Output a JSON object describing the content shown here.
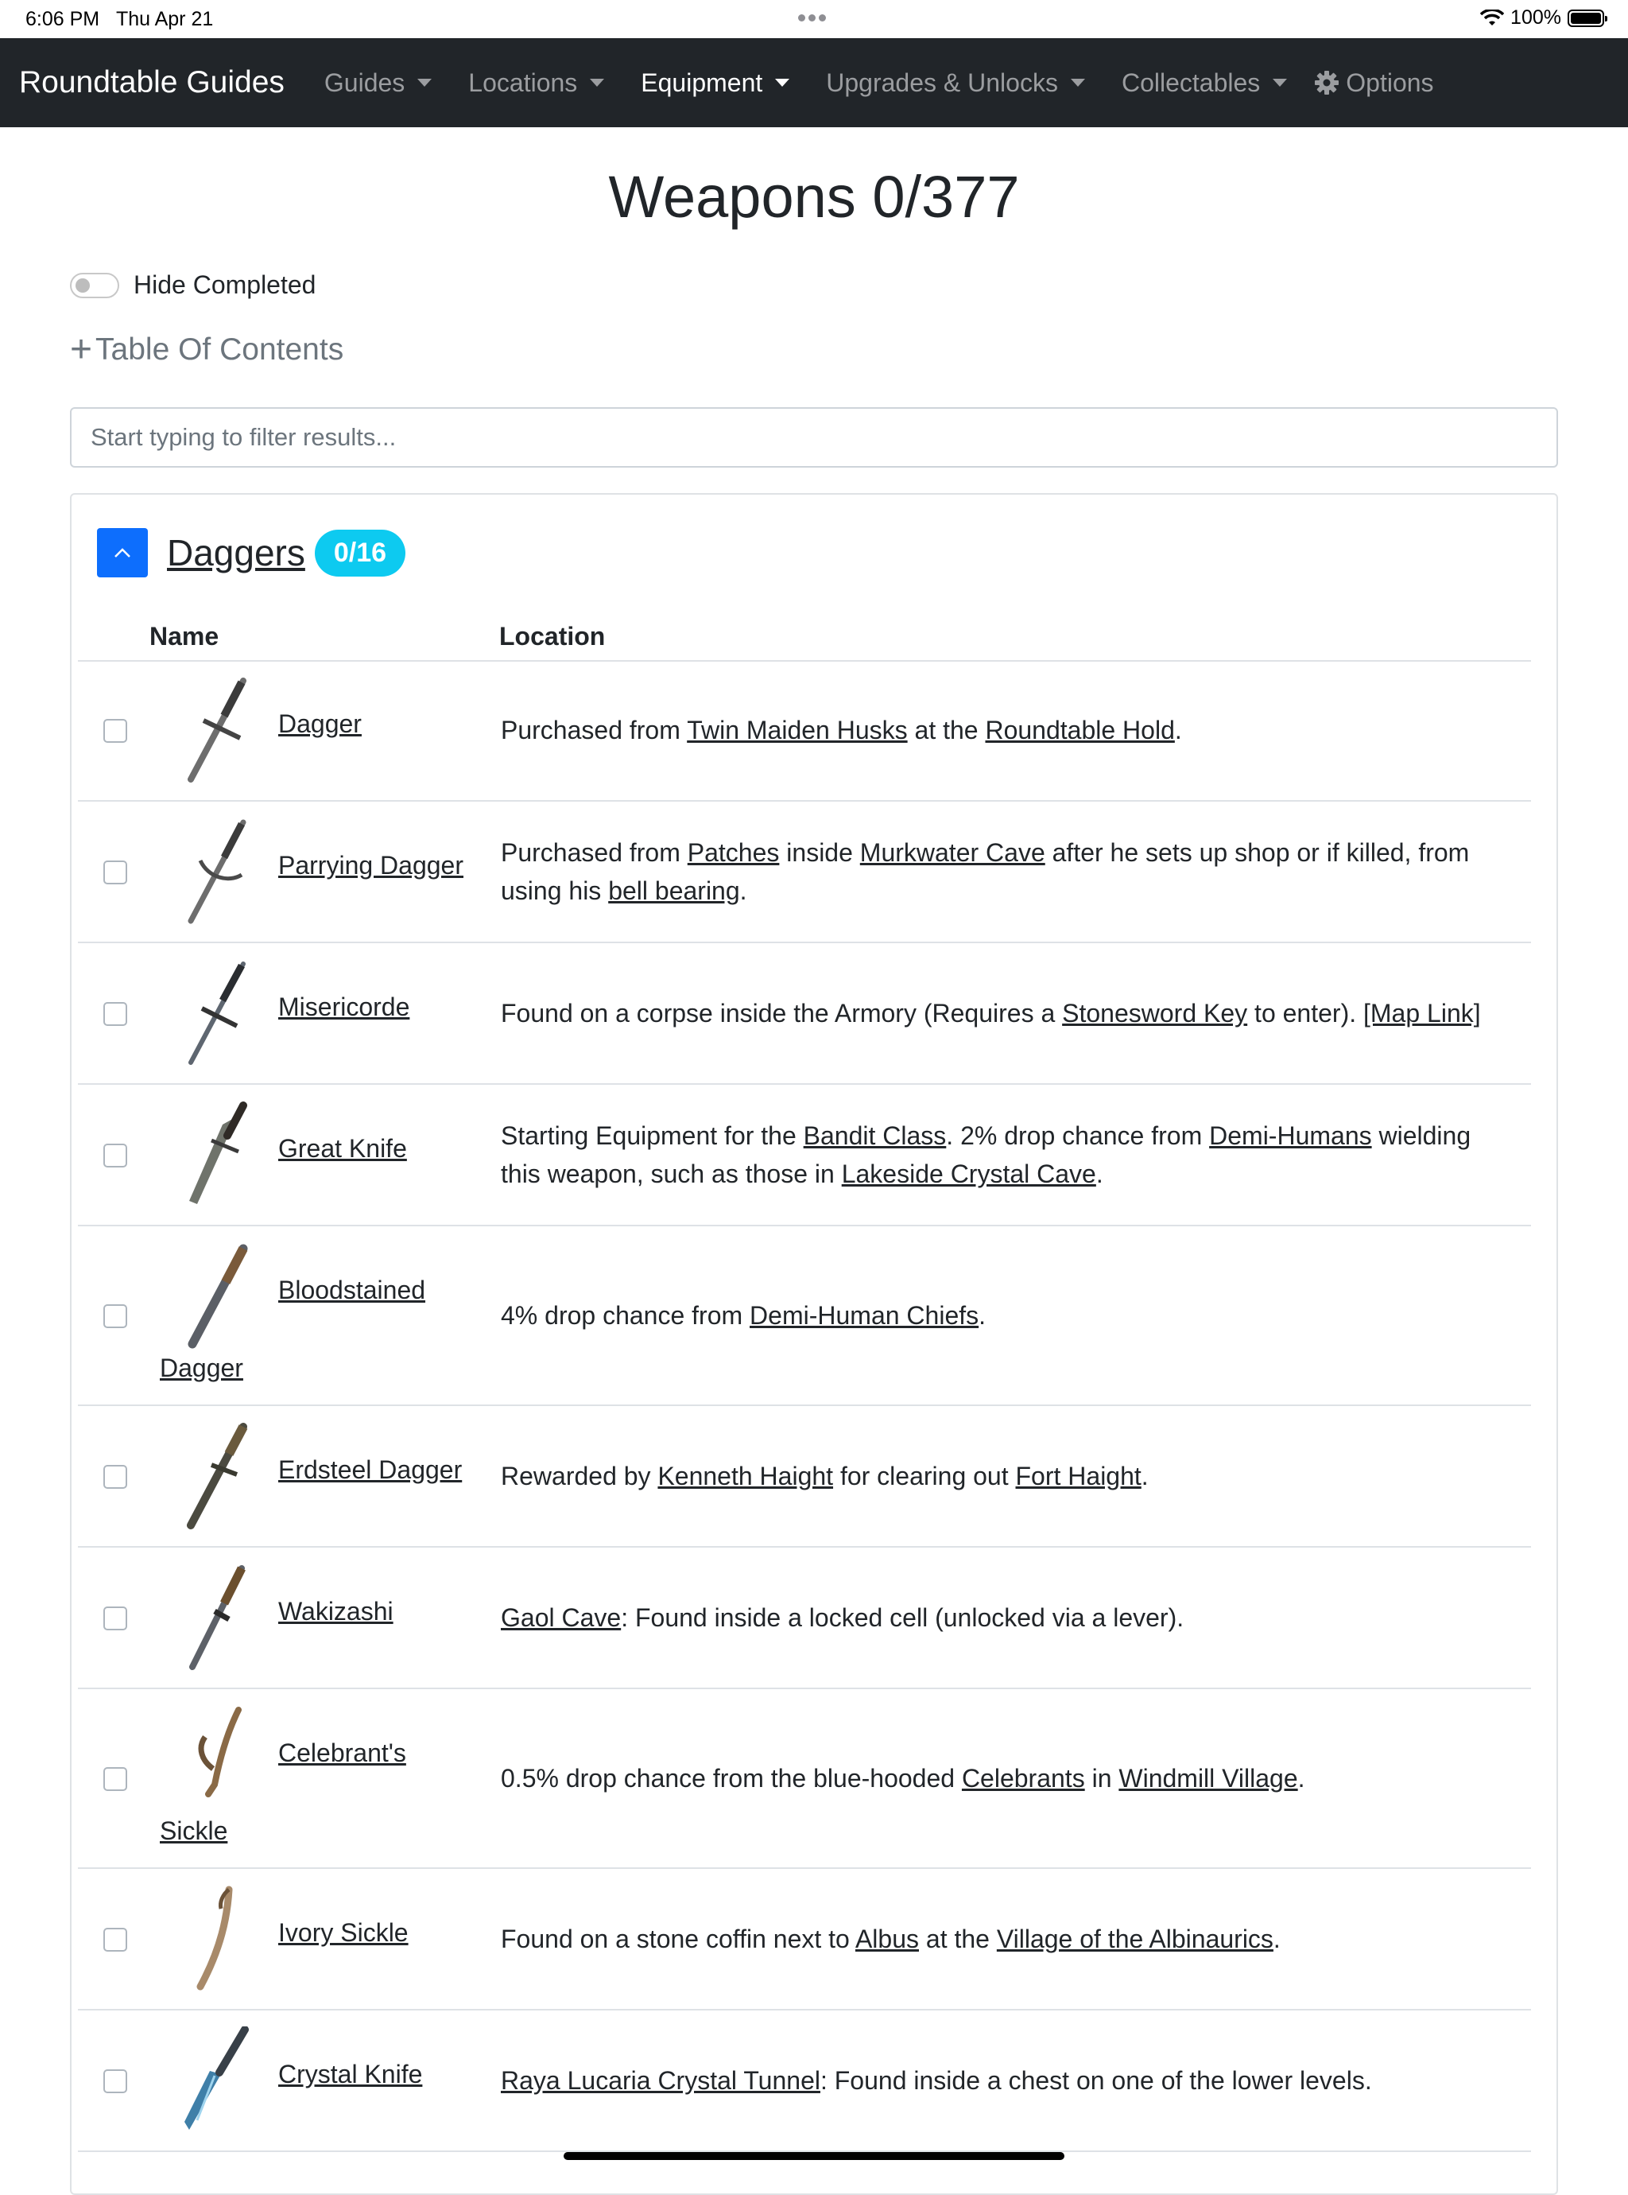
{
  "status": {
    "time": "6:06 PM",
    "date": "Thu Apr 21",
    "battery": "100%"
  },
  "navbar": {
    "brand": "Roundtable Guides",
    "items": [
      {
        "label": "Guides",
        "dropdown": true,
        "active": false
      },
      {
        "label": "Locations",
        "dropdown": true,
        "active": false
      },
      {
        "label": "Equipment",
        "dropdown": true,
        "active": true
      },
      {
        "label": "Upgrades & Unlocks",
        "dropdown": true,
        "active": false
      },
      {
        "label": "Collectables",
        "dropdown": true,
        "active": false
      }
    ],
    "options_label": "Options"
  },
  "page": {
    "title": "Weapons 0/377",
    "hide_completed_label": "Hide Completed",
    "toc_label": "Table Of Contents",
    "filter_placeholder": "Start typing to filter results..."
  },
  "section": {
    "title": "Daggers",
    "badge": "0/16",
    "col_name": "Name",
    "col_location": "Location",
    "rows": [
      {
        "name": "Dagger",
        "segments": [
          {
            "t": "Purchased from "
          },
          {
            "t": "Twin Maiden Husks",
            "link": true
          },
          {
            "t": " at the "
          },
          {
            "t": "Roundtable Hold",
            "link": true
          },
          {
            "t": "."
          }
        ]
      },
      {
        "name": "Parrying Dagger",
        "segments": [
          {
            "t": "Purchased from "
          },
          {
            "t": "Patches",
            "link": true
          },
          {
            "t": " inside "
          },
          {
            "t": "Murkwater Cave",
            "link": true
          },
          {
            "t": " after he sets up shop or if killed, from using his "
          },
          {
            "t": "bell bearing",
            "link": true
          },
          {
            "t": "."
          }
        ]
      },
      {
        "name": "Misericorde",
        "segments": [
          {
            "t": "Found on a corpse inside the Armory (Requires a "
          },
          {
            "t": "Stonesword Key",
            "link": true
          },
          {
            "t": " to enter). "
          },
          {
            "t": "[Map Link]",
            "link": true
          }
        ]
      },
      {
        "name": "Great Knife",
        "segments": [
          {
            "t": "Starting Equipment for the "
          },
          {
            "t": "Bandit Class",
            "link": true
          },
          {
            "t": ". 2% drop chance from "
          },
          {
            "t": "Demi-Humans",
            "link": true
          },
          {
            "t": " wielding this weapon, such as those in "
          },
          {
            "t": "Lakeside Crystal Cave",
            "link": true
          },
          {
            "t": "."
          }
        ]
      },
      {
        "name_line1": "Bloodstained",
        "name_line2": "Dagger",
        "segments": [
          {
            "t": "4% drop chance from "
          },
          {
            "t": "Demi-Human Chiefs",
            "link": true
          },
          {
            "t": "."
          }
        ]
      },
      {
        "name": "Erdsteel Dagger",
        "segments": [
          {
            "t": "Rewarded by "
          },
          {
            "t": "Kenneth Haight",
            "link": true
          },
          {
            "t": " for clearing out "
          },
          {
            "t": "Fort Haight",
            "link": true
          },
          {
            "t": "."
          }
        ]
      },
      {
        "name": "Wakizashi",
        "segments": [
          {
            "t": "Gaol Cave",
            "link": true
          },
          {
            "t": ": Found inside a locked cell (unlocked via a lever)."
          }
        ]
      },
      {
        "name_line1": "Celebrant's",
        "name_line2": "Sickle",
        "segments": [
          {
            "t": "0.5% drop chance from the blue-hooded "
          },
          {
            "t": "Celebrants",
            "link": true
          },
          {
            "t": " in "
          },
          {
            "t": "Windmill Village",
            "link": true
          },
          {
            "t": "."
          }
        ]
      },
      {
        "name": "Ivory Sickle",
        "segments": [
          {
            "t": "Found on a stone coffin next to "
          },
          {
            "t": "Albus",
            "link": true
          },
          {
            "t": " at the "
          },
          {
            "t": "Village of the Albinaurics",
            "link": true
          },
          {
            "t": "."
          }
        ]
      },
      {
        "name": "Crystal Knife",
        "segments": [
          {
            "t": "Raya Lucaria Crystal Tunnel",
            "link": true
          },
          {
            "t": ": Found inside a chest on one of the lower levels."
          }
        ]
      }
    ]
  },
  "colors": {
    "navbar": "#212529",
    "primary": "#0d6efd",
    "badge": "#0dcaf0"
  }
}
